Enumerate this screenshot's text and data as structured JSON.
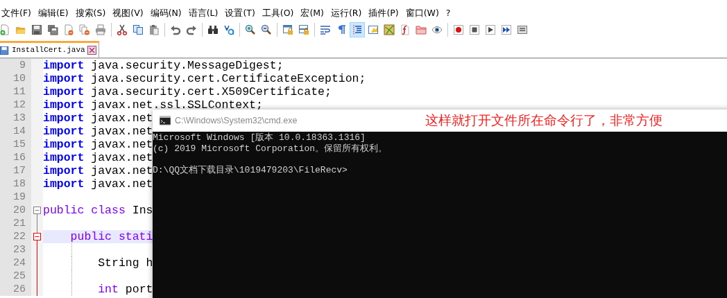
{
  "menu": [
    {
      "label": "文件(F)"
    },
    {
      "label": "编辑(E)"
    },
    {
      "label": "搜索(S)"
    },
    {
      "label": "视图(V)"
    },
    {
      "label": "编码(N)"
    },
    {
      "label": "语言(L)"
    },
    {
      "label": "设置(T)"
    },
    {
      "label": "工具(O)"
    },
    {
      "label": "宏(M)"
    },
    {
      "label": "运行(R)"
    },
    {
      "label": "插件(P)"
    },
    {
      "label": "窗口(W)"
    },
    {
      "label": "?"
    }
  ],
  "toolbar": {
    "buttons": [
      {
        "pressed": false
      },
      {
        "pressed": false
      },
      {
        "pressed": false
      },
      {
        "pressed": false
      },
      {
        "pressed": false
      },
      {
        "pressed": false
      },
      {
        "pressed": false
      },
      {
        "pressed": false
      },
      {
        "pressed": false
      },
      {
        "pressed": false
      },
      {
        "pressed": false
      },
      {
        "pressed": false
      },
      {
        "pressed": false
      },
      {
        "pressed": false
      },
      {
        "pressed": false
      },
      {
        "pressed": false
      },
      {
        "pressed": false
      },
      {
        "pressed": false
      },
      {
        "pressed": false
      },
      {
        "pressed": false
      },
      {
        "pressed": true
      },
      {
        "pressed": false
      },
      {
        "pressed": false
      },
      {
        "pressed": false
      },
      {
        "pressed": false
      },
      {
        "pressed": false
      },
      {
        "pressed": false
      },
      {
        "pressed": false
      },
      {
        "pressed": false
      },
      {
        "pressed": false
      },
      {
        "pressed": false
      }
    ]
  },
  "tabs": [
    {
      "label": "InstallCert.java",
      "selected": true
    }
  ],
  "editor": {
    "lines": [
      {
        "number": "9",
        "current": false,
        "fold_start": false,
        "tokens": [
          {
            "kind": "keyword",
            "text": "import"
          },
          {
            "kind": "plain",
            "text": " java.security.MessageDigest;"
          }
        ]
      },
      {
        "number": "10",
        "current": false,
        "fold_start": false,
        "tokens": [
          {
            "kind": "keyword",
            "text": "import"
          },
          {
            "kind": "plain",
            "text": " java.security.cert.CertificateException;"
          }
        ]
      },
      {
        "number": "11",
        "current": false,
        "fold_start": false,
        "tokens": [
          {
            "kind": "keyword",
            "text": "import"
          },
          {
            "kind": "plain",
            "text": " java.security.cert.X509Certificate;"
          }
        ]
      },
      {
        "number": "12",
        "current": false,
        "fold_start": false,
        "tokens": [
          {
            "kind": "keyword",
            "text": "import"
          },
          {
            "kind": "plain",
            "text": " javax.net.ssl.SSLContext;"
          }
        ]
      },
      {
        "number": "13",
        "current": false,
        "fold_start": false,
        "tokens": [
          {
            "kind": "keyword",
            "text": "import"
          },
          {
            "kind": "plain",
            "text": " javax.net"
          }
        ]
      },
      {
        "number": "14",
        "current": false,
        "fold_start": false,
        "tokens": [
          {
            "kind": "keyword",
            "text": "import"
          },
          {
            "kind": "plain",
            "text": " javax.net"
          }
        ]
      },
      {
        "number": "15",
        "current": false,
        "fold_start": false,
        "tokens": [
          {
            "kind": "keyword",
            "text": "import"
          },
          {
            "kind": "plain",
            "text": " javax.net"
          }
        ]
      },
      {
        "number": "16",
        "current": false,
        "fold_start": false,
        "tokens": [
          {
            "kind": "keyword",
            "text": "import"
          },
          {
            "kind": "plain",
            "text": " javax.net"
          }
        ]
      },
      {
        "number": "17",
        "current": false,
        "fold_start": false,
        "tokens": [
          {
            "kind": "keyword",
            "text": "import"
          },
          {
            "kind": "plain",
            "text": " javax.net"
          }
        ]
      },
      {
        "number": "18",
        "current": false,
        "fold_start": false,
        "tokens": [
          {
            "kind": "keyword",
            "text": "import"
          },
          {
            "kind": "plain",
            "text": " javax.net"
          }
        ]
      },
      {
        "number": "19",
        "current": false,
        "fold_start": false
      },
      {
        "number": "20",
        "current": false,
        "fold_start": true,
        "tokens": [
          {
            "kind": "type",
            "text": "public class"
          },
          {
            "kind": "plain",
            "text": " Ins"
          }
        ]
      },
      {
        "number": "21",
        "current": false,
        "fold_start": false
      },
      {
        "number": "22",
        "current": true,
        "fold_start": true,
        "tokens": [
          {
            "kind": "type",
            "text": "    public stati"
          }
        ]
      },
      {
        "number": "23",
        "current": false,
        "fold_start": false
      },
      {
        "number": "24",
        "current": false,
        "fold_start": false,
        "tokens": [
          {
            "kind": "plain",
            "text": "        String h"
          }
        ]
      },
      {
        "number": "25",
        "current": false,
        "fold_start": false
      },
      {
        "number": "26",
        "current": false,
        "fold_start": false,
        "tokens": [
          {
            "kind": "type",
            "text": "        int"
          },
          {
            "kind": "plain",
            "text": " port"
          }
        ]
      }
    ]
  },
  "console_window": {
    "title": "C:\\Windows\\System32\\cmd.exe",
    "note": "这样就打开文件所在命令行了，非常方便",
    "lines": [
      {
        "text": "Microsoft Windows [版本 10.0.18363.1316]",
        "blank_before": false
      },
      {
        "text": "(c) 2019 Microsoft Corporation。保留所有权利。",
        "blank_before": false
      },
      {
        "text": "D:\\QQ文档下载目录\\1019479203\\FileRecv>",
        "blank_before": true
      }
    ]
  }
}
